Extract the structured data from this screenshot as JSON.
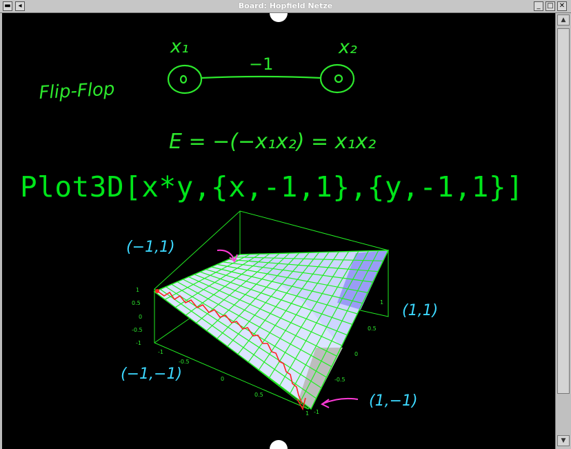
{
  "window": {
    "title": "Board: Hopfield Netze"
  },
  "icons": [
    "menu-icon",
    "pin-icon",
    "minimize-icon",
    "maximize-icon",
    "close-icon"
  ],
  "board": {
    "node_label_1": "x₁",
    "node_label_2": "x₂",
    "edge_weight": "−1",
    "flip_flop": "Flip-Flop",
    "energy_formula": "E = −(−x₁x₂) = x₁x₂",
    "plot_command": "Plot3D[x*y,{x,-1,1},{y,-1,1}]",
    "corner_top_left": "(−1,1)",
    "corner_right": "(1,1)",
    "corner_bottom_left": "(−1,−1)",
    "corner_bottom_right": "(1,−1)"
  },
  "plot": {
    "z_ticks": [
      "1",
      "0.5",
      "0",
      "-0.5",
      "-1"
    ],
    "x_ticks": [
      "-1",
      "-0.5",
      "0",
      "0.5",
      "1"
    ],
    "y_ticks": [
      "1",
      "0.5",
      "0",
      "-0.5",
      "-1"
    ]
  },
  "colors": {
    "ink_green": "#2de82d",
    "ink_cyan": "#3cd8ff",
    "ink_magenta": "#ff3ad8",
    "ink_red": "#ff2222",
    "surface_light": "#dce4ff",
    "surface_blue": "#9a9cf6",
    "grid_green": "#22ee22"
  }
}
